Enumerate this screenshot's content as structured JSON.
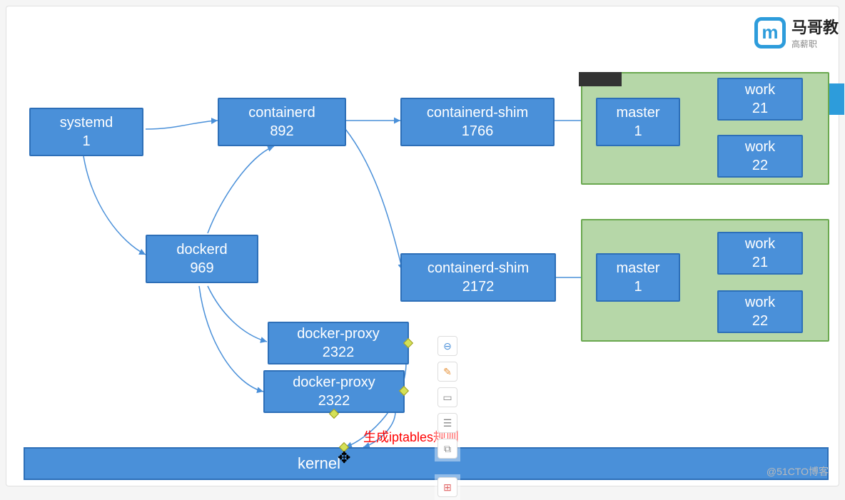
{
  "logo": {
    "title": "马哥教",
    "subtitle": "高薪职"
  },
  "nodes": {
    "systemd": {
      "name": "systemd",
      "pid": "1"
    },
    "containerd": {
      "name": "containerd",
      "pid": "892"
    },
    "shim1": {
      "name": "containerd-shim",
      "pid": "1766"
    },
    "shim2": {
      "name": "containerd-shim",
      "pid": "2172"
    },
    "dockerd": {
      "name": "dockerd",
      "pid": "969"
    },
    "proxy1": {
      "name": "docker-proxy",
      "pid": "2322"
    },
    "proxy2": {
      "name": "docker-proxy",
      "pid": "2322"
    },
    "master1": {
      "name": "master",
      "pid": "1"
    },
    "master2": {
      "name": "master",
      "pid": "1"
    },
    "work1a": {
      "name": "work",
      "pid": "21"
    },
    "work1b": {
      "name": "work",
      "pid": "22"
    },
    "work2a": {
      "name": "work",
      "pid": "21"
    },
    "work2b": {
      "name": "work",
      "pid": "22"
    }
  },
  "kernel": "kernel",
  "annotation": "生成iptables规则",
  "watermark": "@51CTO博客"
}
